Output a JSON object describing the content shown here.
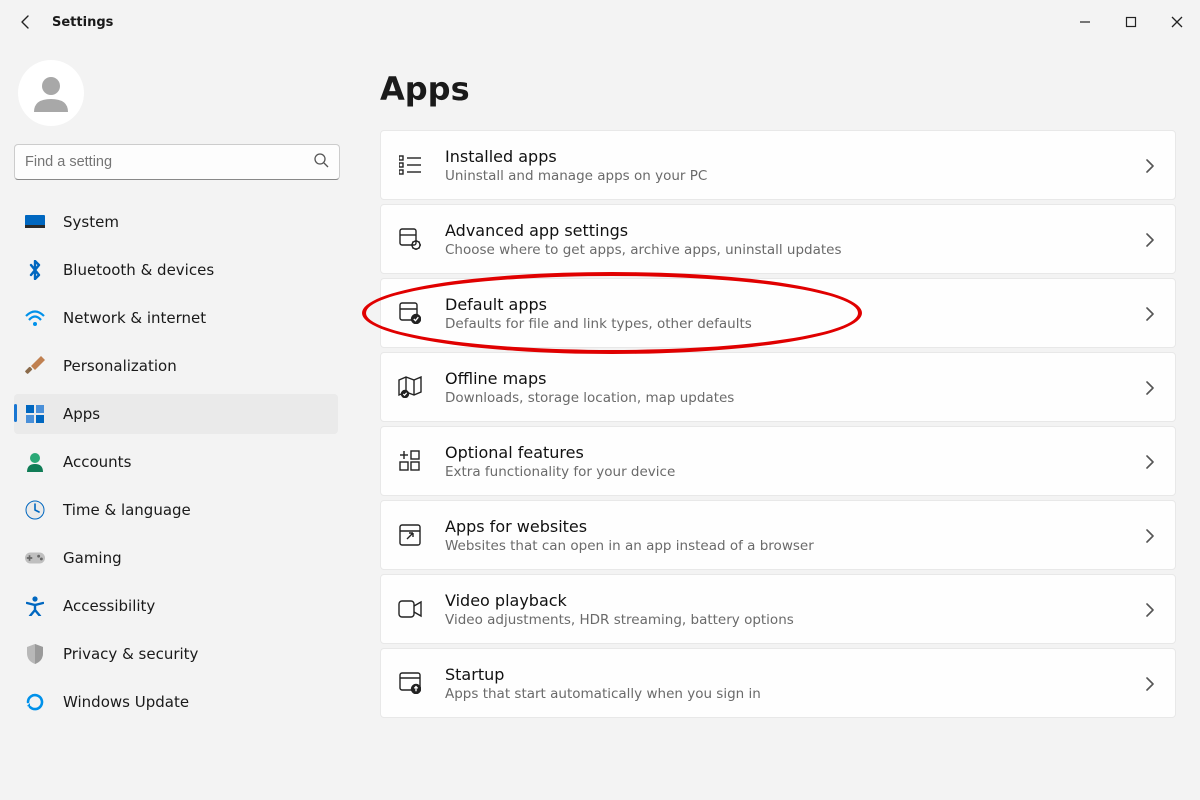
{
  "app_title": "Settings",
  "search_placeholder": "Find a setting",
  "page_title": "Apps",
  "sidebar": {
    "items": [
      {
        "label": "System",
        "icon": "system",
        "active": false
      },
      {
        "label": "Bluetooth & devices",
        "icon": "bluetooth",
        "active": false
      },
      {
        "label": "Network & internet",
        "icon": "network",
        "active": false
      },
      {
        "label": "Personalization",
        "icon": "personalization",
        "active": false
      },
      {
        "label": "Apps",
        "icon": "apps",
        "active": true
      },
      {
        "label": "Accounts",
        "icon": "accounts",
        "active": false
      },
      {
        "label": "Time & language",
        "icon": "time",
        "active": false
      },
      {
        "label": "Gaming",
        "icon": "gaming",
        "active": false
      },
      {
        "label": "Accessibility",
        "icon": "accessibility",
        "active": false
      },
      {
        "label": "Privacy & security",
        "icon": "privacy",
        "active": false
      },
      {
        "label": "Windows Update",
        "icon": "update",
        "active": false
      }
    ]
  },
  "main": {
    "cards": [
      {
        "title": "Installed apps",
        "sub": "Uninstall and manage apps on your PC",
        "icon": "installed"
      },
      {
        "title": "Advanced app settings",
        "sub": "Choose where to get apps, archive apps, uninstall updates",
        "icon": "advanced"
      },
      {
        "title": "Default apps",
        "sub": "Defaults for file and link types, other defaults",
        "icon": "default"
      },
      {
        "title": "Offline maps",
        "sub": "Downloads, storage location, map updates",
        "icon": "maps"
      },
      {
        "title": "Optional features",
        "sub": "Extra functionality for your device",
        "icon": "optional"
      },
      {
        "title": "Apps for websites",
        "sub": "Websites that can open in an app instead of a browser",
        "icon": "websites"
      },
      {
        "title": "Video playback",
        "sub": "Video adjustments, HDR streaming, battery options",
        "icon": "video"
      },
      {
        "title": "Startup",
        "sub": "Apps that start automatically when you sign in",
        "icon": "startup"
      }
    ]
  },
  "annotation": {
    "highlighted_card_index": 2
  }
}
